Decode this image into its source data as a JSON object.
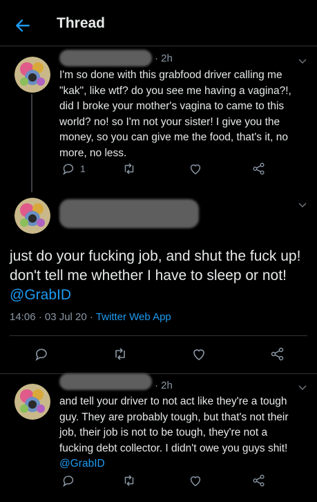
{
  "header": {
    "title": "Thread"
  },
  "tweets": [
    {
      "time": "· 2h",
      "text": "I'm so done with this grabfood driver calling me \"kak\", like wtf? do you see me having a vagina?!, did I broke your mother's vagina to came to this world? no! so I'm not your sister! I give you the money, so you can give me the food, that's it, no more, no less.",
      "reply_count": "1"
    },
    {
      "text_main": "just do your fucking job, and shut the fuck up! don't tell me whether I have to sleep or not!",
      "mention": "@GrabID",
      "timestamp": "14:06 · 03 Jul 20 ·",
      "source": "Twitter Web App"
    },
    {
      "time": "· 2h",
      "text": "and tell your driver to not act like they're a tough guy. They are probably tough, but that's not their job, their job is not to be tough, they're not a fucking debt collector. I didn't owe you guys shit!",
      "mention": "@GrabID"
    }
  ],
  "icons": {
    "back": "arrow-left-icon",
    "caret": "chevron-down-icon",
    "reply": "reply-icon",
    "retweet": "retweet-icon",
    "like": "heart-icon",
    "share": "share-icon"
  },
  "colors": {
    "background": "#000000",
    "accent": "#1d9bf0",
    "muted": "#8b98a5",
    "text": "#e7e9ea"
  }
}
